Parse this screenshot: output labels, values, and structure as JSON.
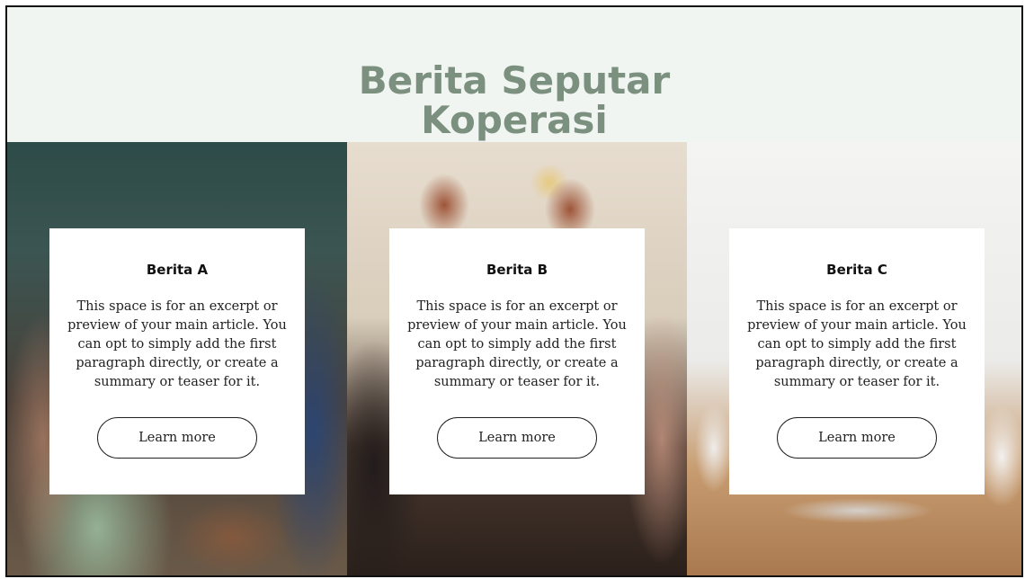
{
  "page": {
    "title": "Berita Seputar Koperasi",
    "accent_color": "#7b907f"
  },
  "articles": [
    {
      "title": "Berita A",
      "excerpt": "This space is for an excerpt or preview of your main article. You can opt to simply add the first paragraph directly, or create a summary or teaser for it.",
      "button_label": "Learn more"
    },
    {
      "title": "Berita B",
      "excerpt": "This space is for an excerpt or preview of your main article. You can opt to simply add the first paragraph directly, or create a summary or teaser for it.",
      "button_label": "Learn more"
    },
    {
      "title": "Berita C",
      "excerpt": "This space is for an excerpt or preview of your main article. You can opt to simply add the first paragraph directly, or create a summary or teaser for it.",
      "button_label": "Learn more"
    }
  ]
}
